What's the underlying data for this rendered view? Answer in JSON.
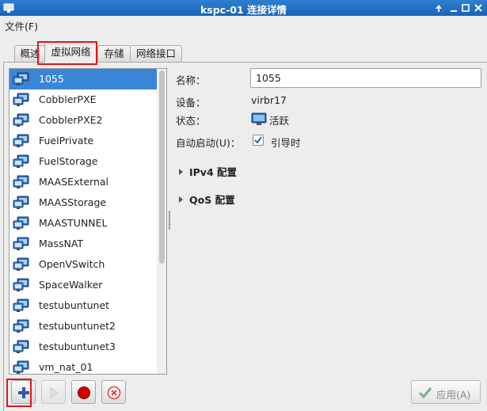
{
  "window": {
    "title": "kspc-01 连接详情"
  },
  "menu": {
    "file": "文件(F)"
  },
  "tabs": [
    {
      "label": "概述"
    },
    {
      "label": "虚拟网络"
    },
    {
      "label": "存储"
    },
    {
      "label": "网络接口"
    }
  ],
  "networks": [
    "1055",
    "CobblerPXE",
    "CobblerPXE2",
    "FuelPrivate",
    "FuelStorage",
    "MAASExternal",
    "MAASStorage",
    "MAASTUNNEL",
    "MassNAT",
    "OpenVSwitch",
    "SpaceWalker",
    "testubuntunet",
    "testubuntunet2",
    "testubuntunet3",
    "vm_nat_01"
  ],
  "selected_network": "1055",
  "details": {
    "name_label": "名称：",
    "name_value": "1055",
    "device_label": "设备：",
    "device_value": "virbr17",
    "state_label": "状态：",
    "state_value": "活跃",
    "autostart_label": "自动启动(U)：",
    "autostart_value": "引导时",
    "autostart_checked": true,
    "ipv4": "IPv4 配置",
    "qos": "QoS 配置"
  },
  "buttons": {
    "apply": "应用(A)"
  },
  "colors": {
    "selection": "#3a86d6",
    "titlebar": "#1a63b8",
    "highlight": "#e0161d",
    "stop": "#d40000"
  }
}
